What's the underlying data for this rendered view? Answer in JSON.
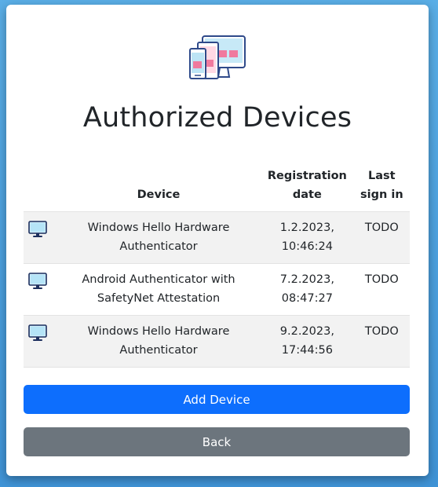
{
  "page": {
    "title": "Authorized Devices",
    "hero_icon": "devices-illustration-icon"
  },
  "table": {
    "headers": {
      "icon": "",
      "device": "Device",
      "registration_date": "Registration date",
      "last_sign_in": "Last sign in"
    },
    "rows": [
      {
        "icon": "monitor-icon",
        "device": "Windows Hello Hardware Authenticator",
        "registration_date": "1.2.2023, 10:46:24",
        "last_sign_in": "TODO"
      },
      {
        "icon": "monitor-icon",
        "device": "Android Authenticator with SafetyNet Attestation",
        "registration_date": "7.2.2023, 08:47:27",
        "last_sign_in": "TODO"
      },
      {
        "icon": "monitor-icon",
        "device": "Windows Hello Hardware Authenticator",
        "registration_date": "9.2.2023, 17:44:56",
        "last_sign_in": "TODO"
      }
    ]
  },
  "actions": {
    "add_device_label": "Add Device",
    "back_label": "Back"
  },
  "colors": {
    "background": "#49a0e0",
    "primary": "#0d6efd",
    "secondary": "#6c757d",
    "striped_row": "#f2f2f2",
    "text": "#212529"
  }
}
